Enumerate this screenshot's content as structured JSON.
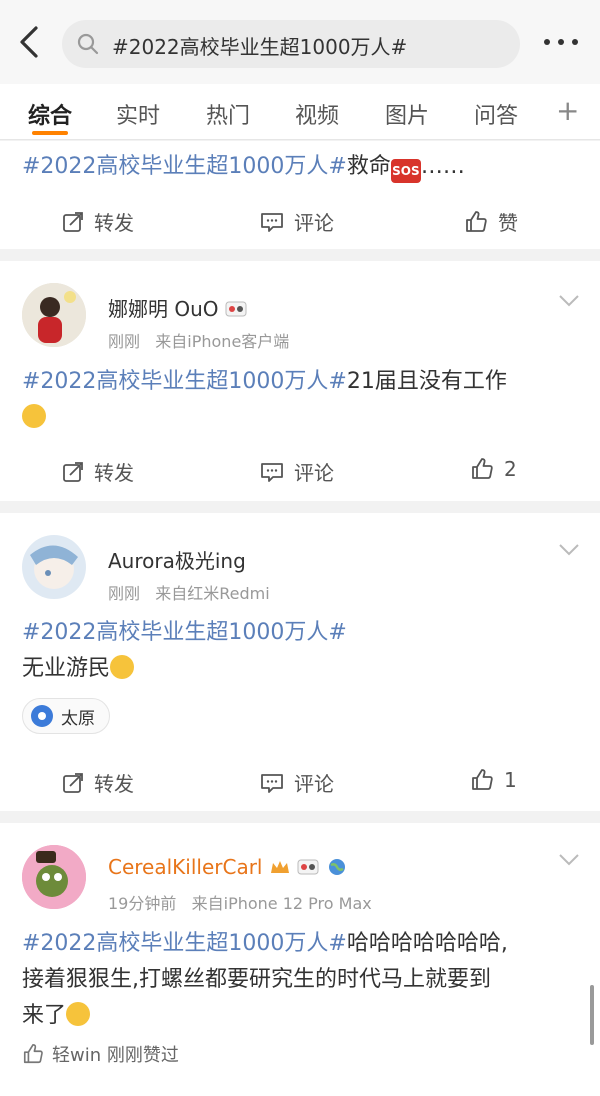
{
  "search": {
    "query": "#2022高校毕业生超1000万人#"
  },
  "tabs": [
    {
      "label": "综合"
    },
    {
      "label": "实时"
    },
    {
      "label": "热门"
    },
    {
      "label": "视频"
    },
    {
      "label": "图片"
    },
    {
      "label": "问答"
    }
  ],
  "actions": {
    "repost": "转发",
    "comment": "评论",
    "like": "赞"
  },
  "posts": [
    {
      "topic": "#2022高校毕业生超1000万人#",
      "text": "救命",
      "emoji": "sos-icon",
      "tail": "……"
    },
    {
      "username": "娜娜明 OuO",
      "time": "刚刚",
      "source": "来自iPhone客户端",
      "topic": "#2022高校毕业生超1000万人#",
      "text": "21届且没有工作",
      "likes": "2"
    },
    {
      "username": "Aurora极光ing",
      "time": "刚刚",
      "source": "来自红米Redmi",
      "topic": "#2022高校毕业生超1000万人#",
      "text": "无业游民",
      "location": "太原",
      "likes": "1"
    },
    {
      "username": "CerealKillerCarl",
      "time": "19分钟前",
      "source": "来自iPhone 12 Pro Max",
      "topic": "#2022高校毕业生超1000万人#",
      "text_line1": "哈哈哈哈哈哈哈,",
      "text_line2": "接着狠狠生,打螺丝都要研究生的时代马上就要到",
      "text_line3": "来了",
      "liked_by": "轻win 刚刚赞过"
    }
  ],
  "colors": {
    "topic": "#5b7fb9",
    "accent": "#ff8200",
    "vip_name": "#e8751a"
  }
}
